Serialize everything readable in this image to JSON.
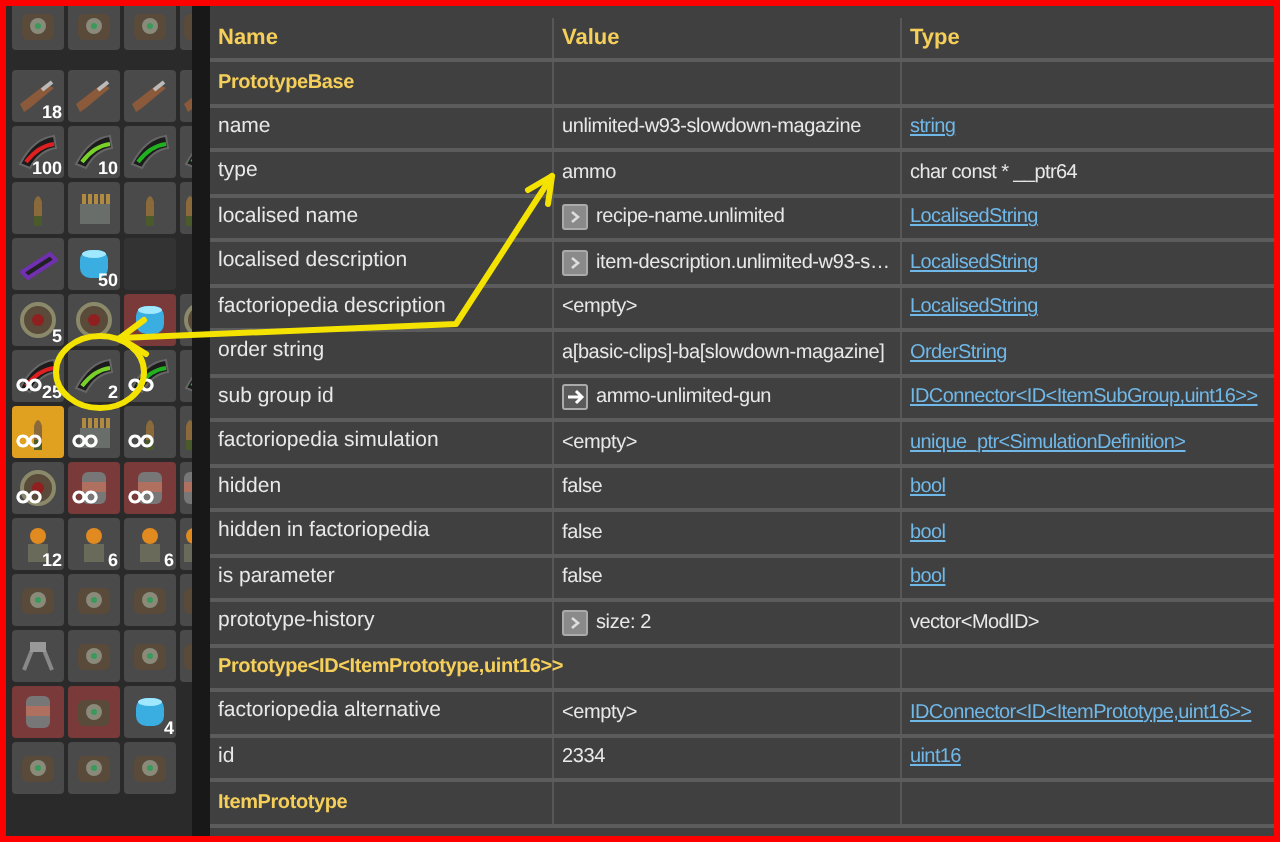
{
  "inventory": {
    "rows": [
      [
        {
          "kind": "machine",
          "selected": false,
          "hidden": false,
          "unlimited": false
        },
        {
          "kind": "machine",
          "selected": false,
          "hidden": false,
          "unlimited": false
        },
        {
          "kind": "machine",
          "selected": false,
          "hidden": false,
          "unlimited": false
        },
        {
          "kind": "machine",
          "selected": false,
          "hidden": false,
          "unlimited": false
        }
      ],
      [
        {
          "kind": "gun",
          "count": "18",
          "selected": false,
          "hidden": false,
          "unlimited": false
        },
        {
          "kind": "gun",
          "selected": false,
          "hidden": false,
          "unlimited": false
        },
        {
          "kind": "gun",
          "selected": false,
          "hidden": false,
          "unlimited": false
        },
        {
          "kind": "gun",
          "selected": false,
          "hidden": false,
          "unlimited": false
        }
      ],
      [
        {
          "kind": "magazine",
          "color": "#e02020",
          "count": "100",
          "selected": false,
          "hidden": false,
          "unlimited": false
        },
        {
          "kind": "magazine",
          "color": "#7ad02a",
          "count": "10",
          "selected": false,
          "hidden": false,
          "unlimited": false
        },
        {
          "kind": "magazine",
          "color": "#20b020",
          "selected": false,
          "hidden": false,
          "unlimited": false
        },
        {
          "kind": "magazine",
          "selected": false,
          "hidden": false,
          "unlimited": false
        }
      ],
      [
        {
          "kind": "bullet",
          "selected": false,
          "hidden": false,
          "unlimited": false
        },
        {
          "kind": "crate",
          "selected": false,
          "hidden": false,
          "unlimited": false
        },
        {
          "kind": "bullet",
          "selected": false,
          "hidden": false,
          "unlimited": false
        },
        {
          "kind": "bullet",
          "selected": false,
          "hidden": false,
          "unlimited": false
        }
      ],
      [
        {
          "kind": "battery",
          "selected": false,
          "hidden": false,
          "unlimited": false
        },
        {
          "kind": "canister",
          "count": "50",
          "selected": false,
          "hidden": false,
          "unlimited": false
        },
        {
          "kind": "empty",
          "selected": false,
          "hidden": false,
          "unlimited": false
        }
      ],
      [
        {
          "kind": "orb",
          "count": "5",
          "selected": false,
          "hidden": false,
          "unlimited": false
        },
        {
          "kind": "orb",
          "selected": false,
          "hidden": false,
          "unlimited": false
        },
        {
          "kind": "canister",
          "selected": false,
          "hidden": true,
          "unlimited": false
        },
        {
          "kind": "orb",
          "selected": false,
          "hidden": false,
          "unlimited": false
        }
      ],
      [
        {
          "kind": "magazine",
          "color": "#e02020",
          "count": "25",
          "selected": false,
          "hidden": false,
          "unlimited": true
        },
        {
          "kind": "magazine",
          "color": "#7ad02a",
          "count": "2",
          "selected": false,
          "hidden": false,
          "unlimited": false
        },
        {
          "kind": "magazine",
          "color": "#20b020",
          "selected": false,
          "hidden": false,
          "unlimited": true
        },
        {
          "kind": "magazine",
          "selected": false,
          "hidden": false,
          "unlimited": false
        }
      ],
      [
        {
          "kind": "bullet",
          "selected": true,
          "hidden": false,
          "unlimited": true
        },
        {
          "kind": "crate",
          "selected": false,
          "hidden": false,
          "unlimited": true
        },
        {
          "kind": "bullet",
          "selected": false,
          "hidden": false,
          "unlimited": true
        },
        {
          "kind": "bullet",
          "selected": false,
          "hidden": false,
          "unlimited": false
        }
      ],
      [
        {
          "kind": "orb",
          "selected": false,
          "hidden": false,
          "unlimited": true
        },
        {
          "kind": "barrel",
          "selected": false,
          "hidden": true,
          "unlimited": true
        },
        {
          "kind": "barrel",
          "selected": false,
          "hidden": true,
          "unlimited": true
        },
        {
          "kind": "barrel",
          "selected": false,
          "hidden": false,
          "unlimited": false
        }
      ],
      [
        {
          "kind": "robot",
          "count": "12",
          "selected": false,
          "hidden": false,
          "unlimited": false
        },
        {
          "kind": "robot",
          "count": "6",
          "selected": false,
          "hidden": false,
          "unlimited": false
        },
        {
          "kind": "robot",
          "count": "6",
          "selected": false,
          "hidden": false,
          "unlimited": false
        },
        {
          "kind": "robot",
          "selected": false,
          "hidden": false,
          "unlimited": false
        }
      ],
      [
        {
          "kind": "machine",
          "selected": false,
          "hidden": false,
          "unlimited": false
        },
        {
          "kind": "machine",
          "selected": false,
          "hidden": false,
          "unlimited": false
        },
        {
          "kind": "machine",
          "selected": false,
          "hidden": false,
          "unlimited": false
        },
        {
          "kind": "machine",
          "selected": false,
          "hidden": false,
          "unlimited": false
        }
      ],
      [
        {
          "kind": "drone",
          "selected": false,
          "hidden": false,
          "unlimited": false
        },
        {
          "kind": "machine",
          "selected": false,
          "hidden": false,
          "unlimited": false
        },
        {
          "kind": "machine",
          "selected": false,
          "hidden": false,
          "unlimited": false
        },
        {
          "kind": "machine",
          "selected": false,
          "hidden": false,
          "unlimited": false
        }
      ],
      [
        {
          "kind": "barrel",
          "selected": false,
          "hidden": true,
          "unlimited": false
        },
        {
          "kind": "machine",
          "selected": false,
          "hidden": true,
          "unlimited": false
        },
        {
          "kind": "canister",
          "count": "4",
          "selected": false,
          "hidden": false,
          "unlimited": false
        }
      ],
      [
        {
          "kind": "machine",
          "selected": false,
          "hidden": false,
          "unlimited": false
        },
        {
          "kind": "machine",
          "selected": false,
          "hidden": false,
          "unlimited": false
        },
        {
          "kind": "machine",
          "selected": false,
          "hidden": false,
          "unlimited": false
        }
      ]
    ]
  },
  "table": {
    "columns": [
      "Name",
      "Value",
      "Type"
    ],
    "rows": [
      {
        "kind": "section",
        "name": "PrototypeBase"
      },
      {
        "kind": "field",
        "name": "name",
        "value": "unlimited-w93-slowdown-magazine",
        "type": "string",
        "link": true,
        "expandable": false,
        "goto": false
      },
      {
        "kind": "field",
        "name": "type",
        "value": "ammo",
        "type": "char const * __ptr64",
        "link": false,
        "expandable": false,
        "goto": false
      },
      {
        "kind": "field",
        "name": "localised name",
        "value": "recipe-name.unlimited",
        "type": "LocalisedString",
        "link": true,
        "expandable": true,
        "goto": false
      },
      {
        "kind": "field",
        "name": "localised description",
        "value": "item-description.unlimited-w93-s…",
        "type": "LocalisedString",
        "link": true,
        "expandable": true,
        "goto": false
      },
      {
        "kind": "field",
        "name": "factoriopedia description",
        "value": "<empty>",
        "type": "LocalisedString",
        "link": true,
        "expandable": false,
        "goto": false
      },
      {
        "kind": "field",
        "name": "order string",
        "value": "a[basic-clips]-ba[slowdown-magazine]",
        "type": "OrderString",
        "link": true,
        "expandable": false,
        "goto": false
      },
      {
        "kind": "field",
        "name": "sub group id",
        "value": "ammo-unlimited-gun",
        "type": "IDConnector<ID<ItemSubGroup,uint16>>",
        "link": true,
        "expandable": false,
        "goto": true
      },
      {
        "kind": "field",
        "name": "factoriopedia simulation",
        "value": "<empty>",
        "type": "unique_ptr<SimulationDefinition>",
        "link": true,
        "expandable": false,
        "goto": false
      },
      {
        "kind": "field",
        "name": "hidden",
        "value": "false",
        "type": "bool",
        "link": true,
        "expandable": false,
        "goto": false
      },
      {
        "kind": "field",
        "name": "hidden in factoriopedia",
        "value": "false",
        "type": "bool",
        "link": true,
        "expandable": false,
        "goto": false
      },
      {
        "kind": "field",
        "name": "is parameter",
        "value": "false",
        "type": "bool",
        "link": true,
        "expandable": false,
        "goto": false
      },
      {
        "kind": "field",
        "name": "prototype-history",
        "value": "size: 2",
        "type": "vector<ModID>",
        "link": false,
        "expandable": true,
        "goto": false
      },
      {
        "kind": "section",
        "name": "Prototype<ID<ItemPrototype,uint16>>"
      },
      {
        "kind": "field",
        "name": "factoriopedia alternative",
        "value": "<empty>",
        "type": "IDConnector<ID<ItemPrototype,uint16>>",
        "link": true,
        "expandable": false,
        "goto": false
      },
      {
        "kind": "field",
        "name": "id",
        "value": "2334",
        "type": "uint16",
        "link": true,
        "expandable": false,
        "goto": false
      },
      {
        "kind": "section",
        "name": "ItemPrototype"
      }
    ]
  }
}
